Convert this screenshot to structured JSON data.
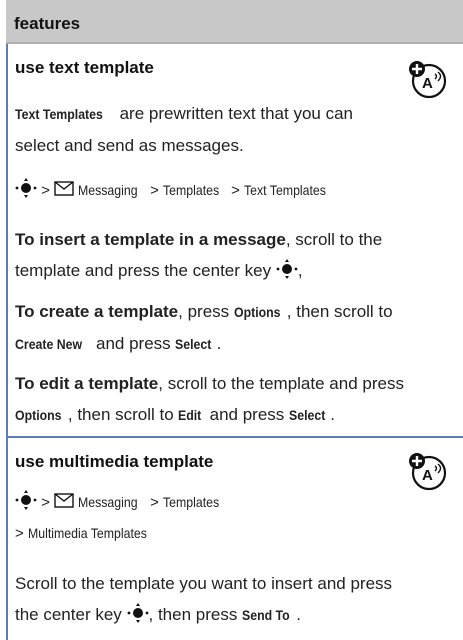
{
  "header": {
    "title": "features"
  },
  "section1": {
    "title": "use text template",
    "intro_term": "Text Templates",
    "intro_rest_1": " are prewritten text that you can",
    "intro_line_2": "select and send as messages.",
    "path": {
      "sep": ">",
      "messaging": "Messaging",
      "templates": "Templates",
      "text_templates": "Text Templates"
    },
    "insert": {
      "bold": "To insert a template in a message",
      "rest_1": ", scroll to the",
      "line_2": "template and press the center key",
      "end": ","
    },
    "create": {
      "bold": "To create a template",
      "rest_1": ", press ",
      "options": "Options",
      "rest_2": ", then scroll to",
      "create_new": "Create New",
      "rest_3": " and press ",
      "select": "Select",
      "end": "."
    },
    "edit": {
      "bold": "To edit a template",
      "rest_1": ", scroll to the template and press",
      "options": "Options",
      "rest_2": ", then scroll to ",
      "edit": "Edit",
      "rest_3": " and press ",
      "select": "Select",
      "end": "."
    }
  },
  "section2": {
    "title": "use multimedia template",
    "path": {
      "sep": ">",
      "messaging": "Messaging",
      "templates": "Templates",
      "mm_templates": "Multimedia Templates"
    },
    "body_line_1": "Scroll to the template you want to insert and press",
    "body_line_2_a": "the center key",
    "body_line_2_b": ", then press ",
    "send_to": "Send To",
    "end": "."
  },
  "colors": {
    "accent_rule": "#5b7fb8",
    "header_band": "#c8c8c8"
  },
  "icons": [
    "feature-availability-icon",
    "nav-key-icon",
    "messaging-envelope-icon"
  ]
}
